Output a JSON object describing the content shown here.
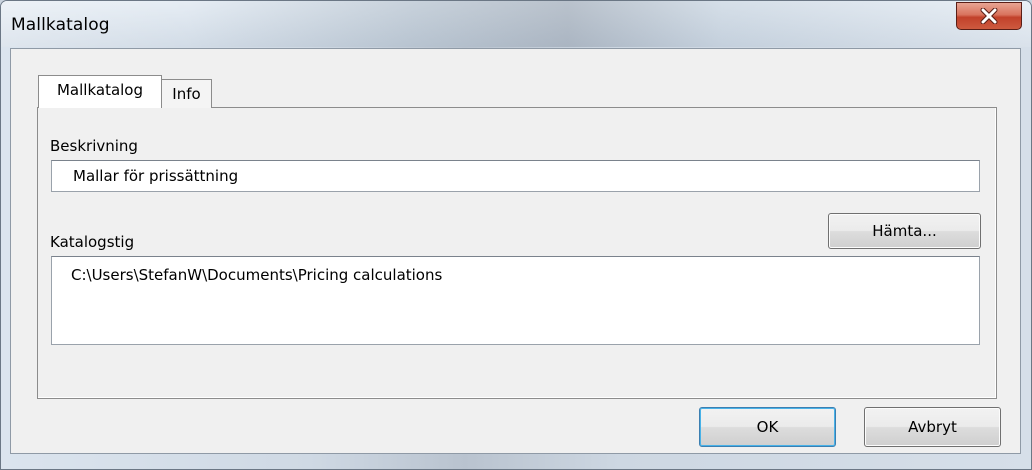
{
  "window": {
    "title": "Mallkatalog"
  },
  "tabs": [
    {
      "label": "Mallkatalog",
      "active": true
    },
    {
      "label": "Info",
      "active": false
    }
  ],
  "form": {
    "description_label": "Beskrivning",
    "description_value": "Mallar för prissättning",
    "path_label": "Katalogstig",
    "path_value": "C:\\Users\\StefanW\\Documents\\Pricing calculations",
    "browse_label": "Hämta..."
  },
  "footer": {
    "ok_label": "OK",
    "cancel_label": "Avbryt"
  },
  "icons": {
    "close": "close-icon"
  },
  "colors": {
    "close_button": "#c8472e",
    "default_button_border": "#3c7fb1",
    "dialog_bg": "#f0f0f0"
  }
}
